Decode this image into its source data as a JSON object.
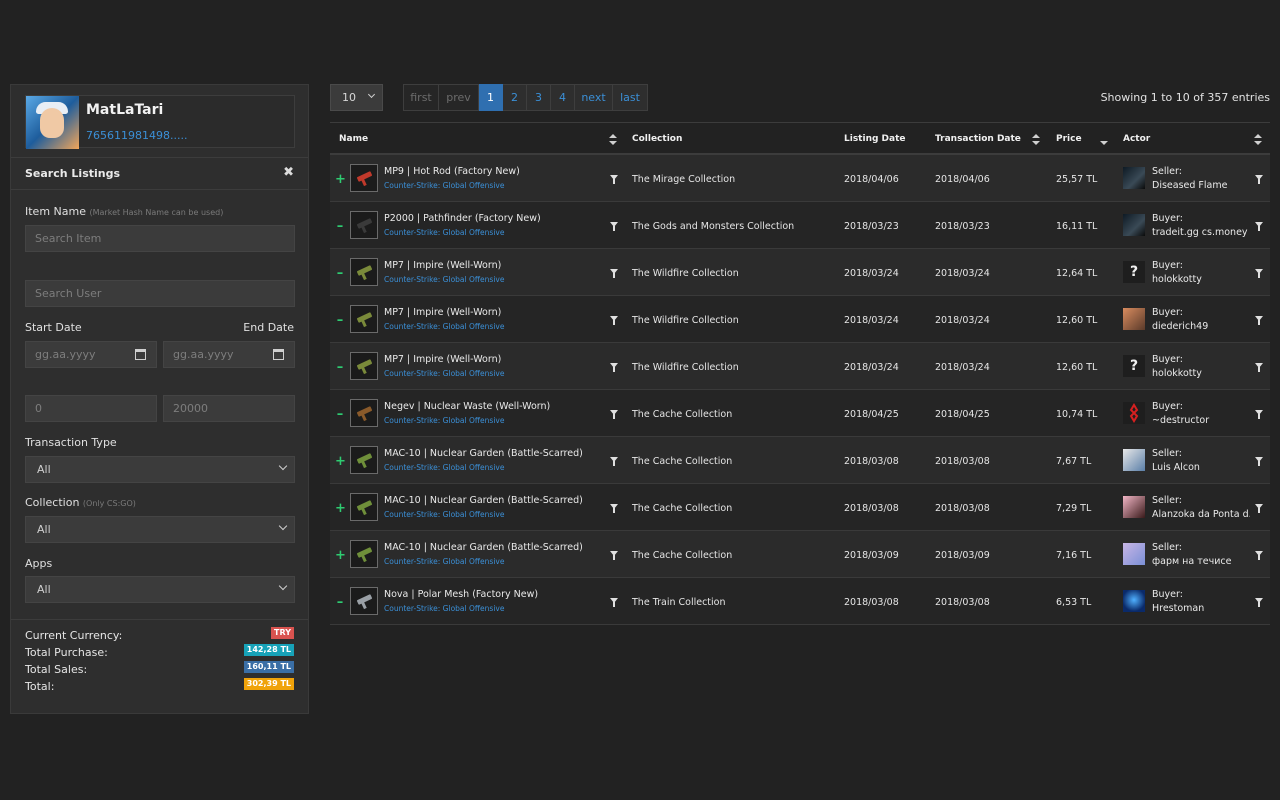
{
  "profile": {
    "name": "MatLaTari",
    "steam_id": "765611981498....."
  },
  "search": {
    "title": "Search Listings",
    "close_glyph": "✖",
    "item_name_label": "Item Name",
    "item_name_hint": "(Market Hash Name can be used)",
    "item_placeholder": "Search Item",
    "user_placeholder": "Search User",
    "start_date_label": "Start Date",
    "end_date_label": "End Date",
    "start_date_placeholder": "gg.aa.yyyy",
    "end_date_placeholder": "gg.aa.yyyy",
    "min_price_placeholder": "0",
    "max_price_placeholder": "20000",
    "transaction_type_label": "Transaction Type",
    "transaction_type_value": "All",
    "collection_label": "Collection",
    "collection_hint": "(Only CS:GO)",
    "collection_value": "All",
    "apps_label": "Apps",
    "apps_value": "All"
  },
  "totals": {
    "currency_label": "Current Currency:",
    "currency_value": "TRY",
    "purchase_label": "Total Purchase:",
    "purchase_value": "142,28 TL",
    "sales_label": "Total Sales:",
    "sales_value": "160,11 TL",
    "total_label": "Total:",
    "total_value": "302,39 TL",
    "colors": {
      "currency": "#d9534f",
      "purchase": "#17a2b8",
      "sales": "#3a6ea5",
      "total": "#f0a30a"
    }
  },
  "controls": {
    "page_length": "10",
    "pager": {
      "first": "first",
      "prev": "prev",
      "pages": [
        "1",
        "2",
        "3",
        "4"
      ],
      "next": "next",
      "last": "last",
      "active_page": "1"
    },
    "showing": "Showing 1 to 10 of 357 entries"
  },
  "table": {
    "headers": {
      "name": "Name",
      "collection": "Collection",
      "listing_date": "Listing Date",
      "transaction_date": "Transaction Date",
      "price": "Price",
      "actor": "Actor"
    },
    "rows": [
      {
        "sign": "+",
        "item": "MP9 | Hot Rod (Factory New)",
        "game": "Counter-Strike: Global Offensive",
        "collection": "The Mirage Collection",
        "listing_date": "2018/04/06",
        "transaction_date": "2018/04/06",
        "price": "25,57 TL",
        "role": "Seller:",
        "actor": "Diseased Flame",
        "avatar": "dark",
        "gun_color": "#c0392b"
      },
      {
        "sign": "–",
        "item": "P2000 | Pathfinder (Factory New)",
        "game": "Counter-Strike: Global Offensive",
        "collection": "The Gods and Monsters Collection",
        "listing_date": "2018/03/23",
        "transaction_date": "2018/03/23",
        "price": "16,11 TL",
        "role": "Buyer:",
        "actor": "tradeit.gg cs.money",
        "avatar": "dark",
        "gun_color": "#3a3a3a"
      },
      {
        "sign": "–",
        "item": "MP7 | Impire (Well-Worn)",
        "game": "Counter-Strike: Global Offensive",
        "collection": "The Wildfire Collection",
        "listing_date": "2018/03/24",
        "transaction_date": "2018/03/24",
        "price": "12,64 TL",
        "role": "Buyer:",
        "actor": "holokkotty",
        "avatar": "question",
        "gun_color": "#7a8a3a"
      },
      {
        "sign": "–",
        "item": "MP7 | Impire (Well-Worn)",
        "game": "Counter-Strike: Global Offensive",
        "collection": "The Wildfire Collection",
        "listing_date": "2018/03/24",
        "transaction_date": "2018/03/24",
        "price": "12,60 TL",
        "role": "Buyer:",
        "actor": "diederich49",
        "avatar": "warm",
        "gun_color": "#7a8a3a"
      },
      {
        "sign": "–",
        "item": "MP7 | Impire (Well-Worn)",
        "game": "Counter-Strike: Global Offensive",
        "collection": "The Wildfire Collection",
        "listing_date": "2018/03/24",
        "transaction_date": "2018/03/24",
        "price": "12,60 TL",
        "role": "Buyer:",
        "actor": "holokkotty",
        "avatar": "question",
        "gun_color": "#7a8a3a"
      },
      {
        "sign": "–",
        "item": "Negev | Nuclear Waste (Well-Worn)",
        "game": "Counter-Strike: Global Offensive",
        "collection": "The Cache Collection",
        "listing_date": "2018/04/25",
        "transaction_date": "2018/04/25",
        "price": "10,74 TL",
        "role": "Buyer:",
        "actor": "~destructor",
        "avatar": "red",
        "gun_color": "#8a5a2a"
      },
      {
        "sign": "+",
        "item": "MAC-10 | Nuclear Garden (Battle-Scarred)",
        "game": "Counter-Strike: Global Offensive",
        "collection": "The Cache Collection",
        "listing_date": "2018/03/08",
        "transaction_date": "2018/03/08",
        "price": "7,67 TL",
        "role": "Seller:",
        "actor": "Luis Alcon",
        "avatar": "light",
        "gun_color": "#6f8f3a"
      },
      {
        "sign": "+",
        "item": "MAC-10 | Nuclear Garden (Battle-Scarred)",
        "game": "Counter-Strike: Global Offensive",
        "collection": "The Cache Collection",
        "listing_date": "2018/03/08",
        "transaction_date": "2018/03/08",
        "price": "7,29 TL",
        "role": "Seller:",
        "actor": "Alanzoka da Ponta d...",
        "avatar": "pink",
        "gun_color": "#6f8f3a"
      },
      {
        "sign": "+",
        "item": "MAC-10 | Nuclear Garden (Battle-Scarred)",
        "game": "Counter-Strike: Global Offensive",
        "collection": "The Cache Collection",
        "listing_date": "2018/03/09",
        "transaction_date": "2018/03/09",
        "price": "7,16 TL",
        "role": "Seller:",
        "actor": "фарм на течисе",
        "avatar": "lilac",
        "gun_color": "#6f8f3a"
      },
      {
        "sign": "–",
        "item": "Nova | Polar Mesh (Factory New)",
        "game": "Counter-Strike: Global Offensive",
        "collection": "The Train Collection",
        "listing_date": "2018/03/08",
        "transaction_date": "2018/03/08",
        "price": "6,53 TL",
        "role": "Buyer:",
        "actor": "Hrestoman",
        "avatar": "blue",
        "gun_color": "#9aa0a6"
      }
    ]
  }
}
